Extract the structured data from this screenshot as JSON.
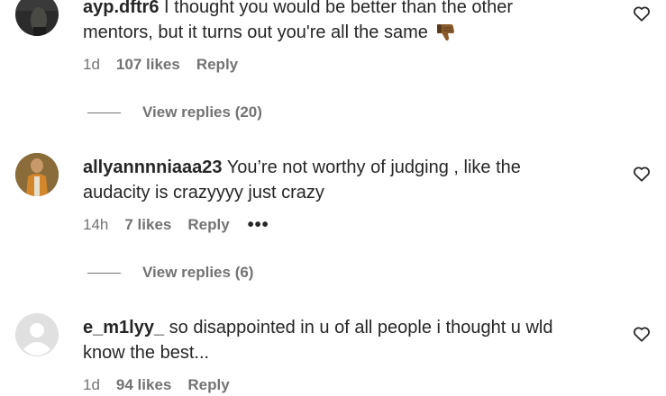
{
  "comments": [
    {
      "username": "ayp.dftr6",
      "text": "I thought you would be better than the other mentors, but it turns out you're all the same",
      "emoji": "thumbs-down",
      "time": "1d",
      "likes": "107 likes",
      "reply_label": "Reply",
      "view_replies": "View replies (20)"
    },
    {
      "username": "allyannnniaaa23",
      "text": "You’re not worthy of judging , like the audacity is crazyyyy just crazy",
      "time": "14h",
      "likes": "7 likes",
      "reply_label": "Reply",
      "more": "•••",
      "view_replies": "View replies (6)"
    },
    {
      "username": "e_m1lyy_",
      "text": "so disappointed in u of all people i thought u wld know the best...",
      "time": "1d",
      "likes": "94 likes",
      "reply_label": "Reply"
    }
  ],
  "icons": {
    "like": "heart-outline-icon",
    "emoji": "thumbs-down-icon",
    "avatar_default": "default-avatar-icon"
  },
  "colors": {
    "text": "#262626",
    "secondary": "#737373",
    "emoji": "#8a5a2b"
  }
}
